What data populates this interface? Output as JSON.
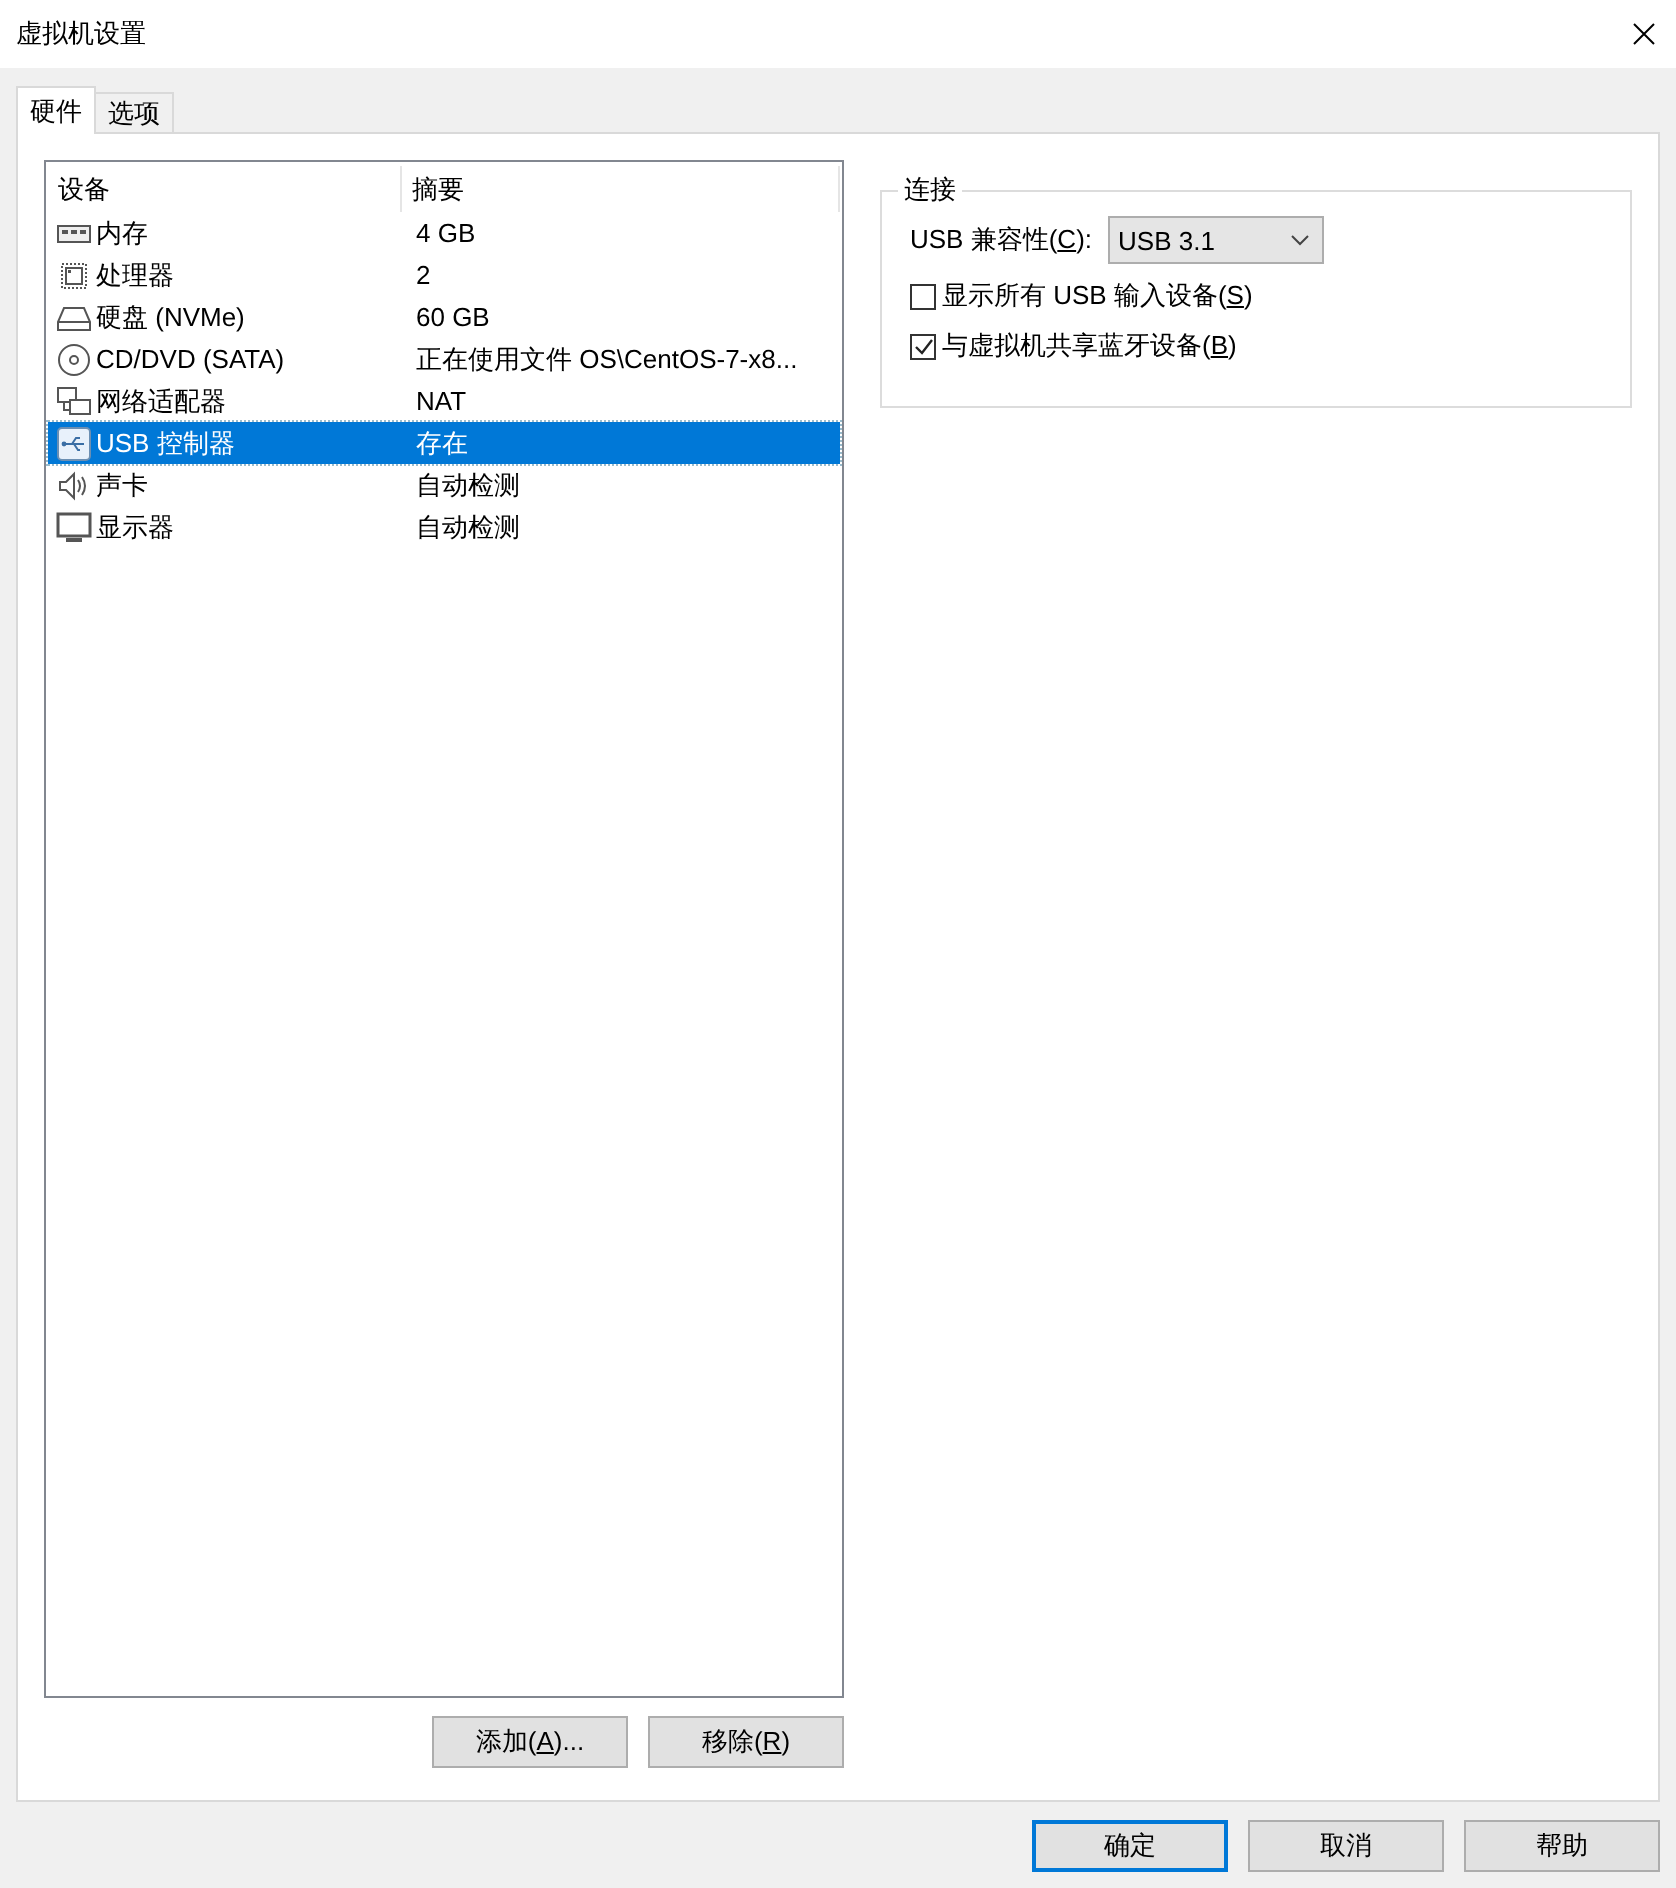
{
  "window": {
    "title": "虚拟机设置"
  },
  "tabs": [
    {
      "label": "硬件",
      "selected": true
    },
    {
      "label": "选项",
      "selected": false
    }
  ],
  "device_list": {
    "columns": [
      "设备",
      "摘要"
    ],
    "rows": [
      {
        "kind": "memory",
        "device": "内存",
        "summary": "4 GB",
        "selected": false
      },
      {
        "kind": "processor",
        "device": "处理器",
        "summary": "2",
        "selected": false
      },
      {
        "kind": "disk",
        "device": "硬盘 (NVMe)",
        "summary": "60 GB",
        "selected": false
      },
      {
        "kind": "cd",
        "device": "CD/DVD (SATA)",
        "summary": "正在使用文件 OS\\CentOS-7-x8...",
        "selected": false
      },
      {
        "kind": "network",
        "device": "网络适配器",
        "summary": "NAT",
        "selected": false
      },
      {
        "kind": "usb",
        "device": "USB 控制器",
        "summary": "存在",
        "selected": true
      },
      {
        "kind": "sound",
        "device": "声卡",
        "summary": "自动检测",
        "selected": false
      },
      {
        "kind": "display",
        "device": "显示器",
        "summary": "自动检测",
        "selected": false
      }
    ]
  },
  "list_buttons": [
    {
      "before": "添加(",
      "key": "A",
      "after": ")..."
    },
    {
      "before": "移除(",
      "key": "R",
      "after": ")"
    }
  ],
  "connection": {
    "title": "连接",
    "compatibility": {
      "label": {
        "before": "USB 兼容性(",
        "key": "C",
        "after": "):"
      },
      "value": "USB 3.1"
    },
    "options": [
      {
        "before": "显示所有 USB 输入设备(",
        "key": "S",
        "after": ")",
        "checked": false
      },
      {
        "before": "与虚拟机共享蓝牙设备(",
        "key": "B",
        "after": ")",
        "checked": true
      }
    ]
  },
  "dialog_buttons": [
    {
      "label": "确定",
      "default": true
    },
    {
      "label": "取消",
      "default": false
    },
    {
      "label": "帮助",
      "default": false
    }
  ]
}
